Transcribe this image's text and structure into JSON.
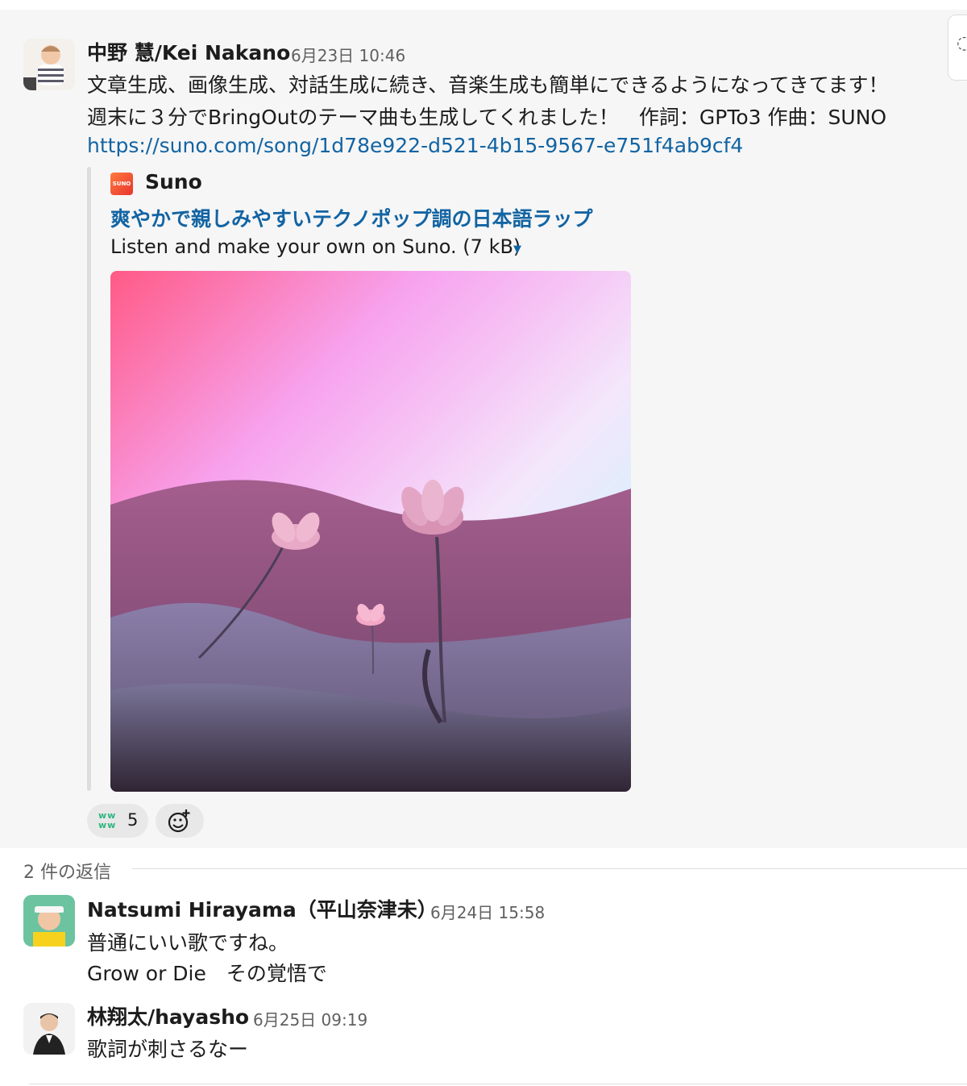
{
  "message": {
    "author": "中野 慧/Kei Nakano",
    "timestamp": "6月23日 10:46",
    "lines": [
      "文章生成、画像生成、対話生成に続き、音楽生成も簡単にできるようになってきてます！",
      "週末に３分でBringOutのテーマ曲も生成してくれました！　作詞：GPTo3 作曲：SUNO"
    ],
    "link": "https://suno.com/song/1d78e922-d521-4b15-9567-e751f4ab9cf4",
    "unfurl": {
      "site_logo_text": "SUNO",
      "site_name": "Suno",
      "title": "爽やかで親しみやすいテクノポップ調の日本語ラップ",
      "description": "Listen and make your own on Suno. (7 kB)",
      "caret_icon": "caret-down-icon"
    },
    "reaction": {
      "emoji_text": "ww\nww",
      "count": "5"
    },
    "add_reaction_icon": "add-reaction-icon"
  },
  "thread": {
    "replies_label": "2 件の返信",
    "replies": [
      {
        "author": "Natsumi Hirayama（平山奈津未）",
        "timestamp": "6月24日 15:58",
        "lines": [
          "普通にいい歌ですね。",
          "Grow or Die　その覚悟で"
        ]
      },
      {
        "author": "林翔太/hayasho",
        "timestamp": "6月25日 09:19",
        "lines": [
          "歌詞が刺さるなー"
        ]
      }
    ]
  },
  "colors": {
    "link": "#1264a3",
    "reaction_green": "#2eb67d",
    "message_bg": "#f6f6f6"
  }
}
